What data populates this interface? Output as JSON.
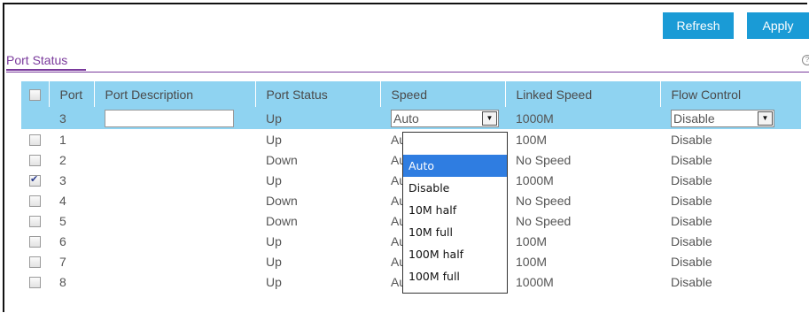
{
  "toolbar": {
    "refresh_label": "Refresh",
    "apply_label": "Apply"
  },
  "section": {
    "title": "Port Status",
    "help_icon": "help-icon"
  },
  "table": {
    "headers": [
      "Port",
      "Port Description",
      "Port Status",
      "Speed",
      "Linked Speed",
      "Flow Control"
    ],
    "edit_row": {
      "port": "3",
      "description": "",
      "status": "Up",
      "speed": "Auto",
      "linked_speed": "1000M",
      "flow_control": "Disable"
    },
    "rows": [
      {
        "checked": false,
        "port": "1",
        "description": "",
        "status": "Up",
        "speed": "Auto",
        "linked_speed": "100M",
        "flow_control": "Disable"
      },
      {
        "checked": false,
        "port": "2",
        "description": "",
        "status": "Down",
        "speed": "Auto",
        "linked_speed": "No Speed",
        "flow_control": "Disable"
      },
      {
        "checked": true,
        "port": "3",
        "description": "",
        "status": "Up",
        "speed": "Auto",
        "linked_speed": "1000M",
        "flow_control": "Disable"
      },
      {
        "checked": false,
        "port": "4",
        "description": "",
        "status": "Down",
        "speed": "Auto",
        "linked_speed": "No Speed",
        "flow_control": "Disable"
      },
      {
        "checked": false,
        "port": "5",
        "description": "",
        "status": "Down",
        "speed": "Auto",
        "linked_speed": "No Speed",
        "flow_control": "Disable"
      },
      {
        "checked": false,
        "port": "6",
        "description": "",
        "status": "Up",
        "speed": "Auto",
        "linked_speed": "100M",
        "flow_control": "Disable"
      },
      {
        "checked": false,
        "port": "7",
        "description": "",
        "status": "Up",
        "speed": "Auto",
        "linked_speed": "100M",
        "flow_control": "Disable"
      },
      {
        "checked": false,
        "port": "8",
        "description": "",
        "status": "Up",
        "speed": "Auto",
        "linked_speed": "1000M",
        "flow_control": "Disable"
      }
    ]
  },
  "speed_dropdown": {
    "open": true,
    "options": [
      "Auto",
      "Disable",
      "10M half",
      "10M full",
      "100M half",
      "100M full"
    ],
    "highlighted": "Auto"
  },
  "colors": {
    "accent": "#1a9bd6",
    "header_bg": "#8fd3f1",
    "section": "#7a3a9c",
    "highlight": "#2f7de1"
  }
}
